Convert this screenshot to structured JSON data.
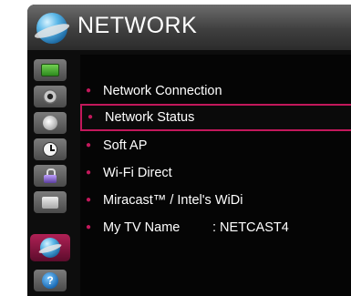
{
  "header": {
    "title": "NETWORK",
    "icon": "network-globe-icon"
  },
  "sidebar": {
    "items": [
      {
        "name": "picture",
        "icon": "tv-icon",
        "active": false
      },
      {
        "name": "audio",
        "icon": "speaker-icon",
        "active": false
      },
      {
        "name": "setup",
        "icon": "disc-icon",
        "active": false
      },
      {
        "name": "time",
        "icon": "clock-icon",
        "active": false
      },
      {
        "name": "lock",
        "icon": "lock-icon",
        "active": false
      },
      {
        "name": "option",
        "icon": "option-icon",
        "active": false
      },
      {
        "name": "network",
        "icon": "network-globe-icon",
        "active": true
      },
      {
        "name": "support",
        "icon": "help-icon",
        "glyph": "?",
        "active": false
      }
    ]
  },
  "menu": {
    "selected_index": 1,
    "items": [
      {
        "label": "Network Connection"
      },
      {
        "label": "Network Status"
      },
      {
        "label": "Soft AP"
      },
      {
        "label": "Wi-Fi Direct"
      },
      {
        "label": "Miracast™ / Intel's WiDi"
      },
      {
        "label": "My TV Name",
        "value": ": NETCAST4"
      }
    ]
  },
  "colors": {
    "accent": "#c2185b",
    "background": "#0d0d0d",
    "text": "#ffffff"
  }
}
